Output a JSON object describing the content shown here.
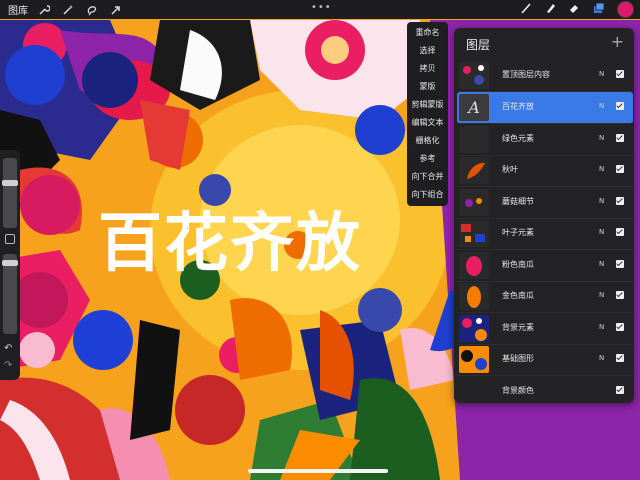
{
  "toolbar": {
    "gallery_label": "图库",
    "icons": [
      "wrench-icon",
      "magic-wand-icon",
      "selection-icon",
      "transform-arrow-icon"
    ],
    "more_label": "•••",
    "right_icons": [
      "brush-icon",
      "smudge-icon",
      "eraser-icon",
      "layers-icon"
    ],
    "color_swatch": "#e0196f"
  },
  "artwork": {
    "title_text": "百花齐放"
  },
  "layer_menu": {
    "items": [
      "重命名",
      "选择",
      "拷贝",
      "蒙版",
      "剪辑蒙版",
      "编辑文本",
      "栅格化",
      "参考",
      "向下合并",
      "向下组合"
    ]
  },
  "layers_panel": {
    "title": "图层",
    "add_label": "+",
    "layers": [
      {
        "name": "置顶图层内容",
        "mode": "N",
        "visible": true,
        "selected": false
      },
      {
        "name": "百花齐放",
        "mode": "N",
        "visible": true,
        "selected": true,
        "thumb_glyph": "A"
      },
      {
        "name": "绿色元素",
        "mode": "N",
        "visible": true,
        "selected": false
      },
      {
        "name": "秋叶",
        "mode": "N",
        "visible": true,
        "selected": false
      },
      {
        "name": "蘑菇细节",
        "mode": "N",
        "visible": true,
        "selected": false
      },
      {
        "name": "叶子元素",
        "mode": "N",
        "visible": true,
        "selected": false
      },
      {
        "name": "粉色南瓜",
        "mode": "N",
        "visible": true,
        "selected": false
      },
      {
        "name": "金色南瓜",
        "mode": "N",
        "visible": true,
        "selected": false
      },
      {
        "name": "背景元素",
        "mode": "N",
        "visible": true,
        "selected": false
      },
      {
        "name": "基础图形",
        "mode": "N",
        "visible": true,
        "selected": false
      },
      {
        "name": "背景颜色",
        "mode": "",
        "visible": true,
        "selected": false
      }
    ]
  },
  "colors": {
    "accent_selected": "#3a7ae6",
    "panel_bg": "#232325"
  }
}
